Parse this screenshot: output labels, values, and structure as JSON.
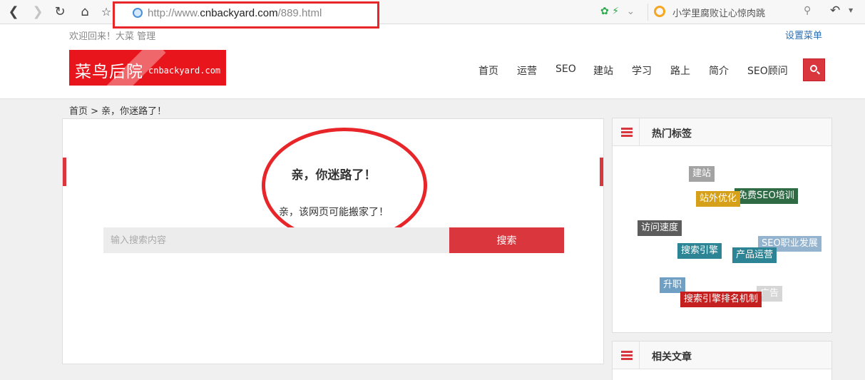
{
  "browser": {
    "url_prefix": "http://www.",
    "url_host": "cnbackyard.com",
    "url_path": "/889.html",
    "search_text": "小学里腐败让心惊肉跳"
  },
  "header": {
    "welcome": "欢迎回来！大菜  管理",
    "settings_menu": "设置菜单",
    "logo_cn": "菜鸟后院",
    "logo_en": "cnbackyard.com",
    "nav": [
      "首页",
      "运营",
      "SEO",
      "建站",
      "学习",
      "路上",
      "简介",
      "SEO顾问"
    ]
  },
  "breadcrumb": "首页 > 亲，你迷路了！",
  "main": {
    "title": "亲，你迷路了！",
    "description": "亲，该网页可能搬家了！",
    "search_placeholder": "输入搜索内容",
    "search_button": "搜索"
  },
  "sidebar": {
    "hot_tags_title": "热门标签",
    "related_title": "相关文章",
    "tags": [
      {
        "text": "建站",
        "color": "#a3a3a3"
      },
      {
        "text": "免费SEO培训",
        "color": "#2e6b45"
      },
      {
        "text": "站外优化",
        "color": "#d6a01a"
      },
      {
        "text": "访问速度",
        "color": "#5c5c5c"
      },
      {
        "text": "SEO职业发展",
        "color": "#93b3cf"
      },
      {
        "text": "搜索引擎",
        "color": "#2c8494"
      },
      {
        "text": "产品运营",
        "color": "#2c8494"
      },
      {
        "text": "升职",
        "color": "#6f9fc3"
      },
      {
        "text": "广告",
        "color": "#d6d6d6"
      },
      {
        "text": "搜索引擎排名机制",
        "color": "#c42020"
      }
    ]
  },
  "colors": {
    "accent": "#d9363e",
    "logo_red": "#e8161c",
    "annotation_red": "#e8262a"
  }
}
